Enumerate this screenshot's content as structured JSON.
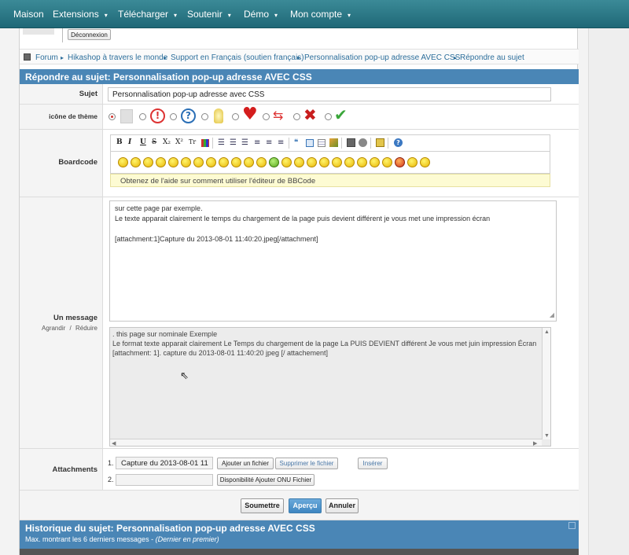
{
  "nav": {
    "items": [
      {
        "label": "Maison",
        "dropdown": false
      },
      {
        "label": "Extensions",
        "dropdown": true
      },
      {
        "label": "Télécharger",
        "dropdown": true
      },
      {
        "label": "Soutenir",
        "dropdown": true
      },
      {
        "label": "Démo",
        "dropdown": true
      },
      {
        "label": "Mon compte",
        "dropdown": true
      }
    ],
    "caret": "▾"
  },
  "user": {
    "logout_label": "Déconnexion"
  },
  "breadcrumb": [
    "Forum",
    "Hikashop à travers le monde",
    "Support en Français (soutien français)",
    "Personnalisation pop-up adresse AVEC CSS",
    "Répondre au sujet"
  ],
  "reply": {
    "heading": "Répondre au sujet: Personnalisation pop-up adresse AVEC CSS",
    "subject_label": "Sujet",
    "subject_value": "Personnalisation pop-up adresse avec CSS",
    "icon_label": "icône de thème",
    "boardcode_label": "Boardcode",
    "help_text": "Obtenez de l'aide sur comment utiliser l'éditeur de BBCode",
    "message_label": "Un message",
    "resize_enlarge": "Agrandir",
    "resize_sep": "/",
    "resize_reduce": "Réduire",
    "message_lines": [
      "sur cette page par exemple.",
      "Le texte apparait clairement le temps du chargement de la page puis devient différent je vous met une impression écran",
      "",
      "[attachment:1]Capture du 2013-08-01 11:40:20.jpeg[/attachment]"
    ],
    "preview_lines": [
      ". this page sur nominale Exemple",
      "Le format texte apparait clairement Le Temps du chargement de la page La PUIS DEVIENT différent Je vous met juin impression Écran",
      "[attachment: 1]. capture du 2013-08-01 11:40:20 jpeg [/ attachement]"
    ],
    "attachments_label": "Attachments",
    "attachment1_index": "1.",
    "attachment1_value": "Capture du 2013-08-01 11",
    "attachment1_add": "Ajouter un fichier",
    "attachment1_remove": "Supprimer le fichier",
    "attachment1_insert": "Insérer",
    "attachment2_index": "2.",
    "attachment2_value": "",
    "attachment2_btn": "Disponibilité Ajouter ONU Fichier",
    "submit_label": "Soumettre",
    "preview_label": "Aperçu",
    "cancel_label": "Annuler"
  },
  "toolbar": {
    "buttons": [
      "B",
      "I",
      "U",
      "S",
      "X₂",
      "X²",
      "Tr",
      "A"
    ]
  },
  "history": {
    "heading": "Historique du sujet: Personnalisation pop-up adresse AVEC CSS",
    "subtext_prefix": "Max. montrant les 6 derniers messages - ",
    "subtext_em": "(Dernier en premier)"
  },
  "colors": {
    "nav_bg": "#2a7886",
    "section_bg": "#4a86b6",
    "link": "#2c6e9b"
  }
}
